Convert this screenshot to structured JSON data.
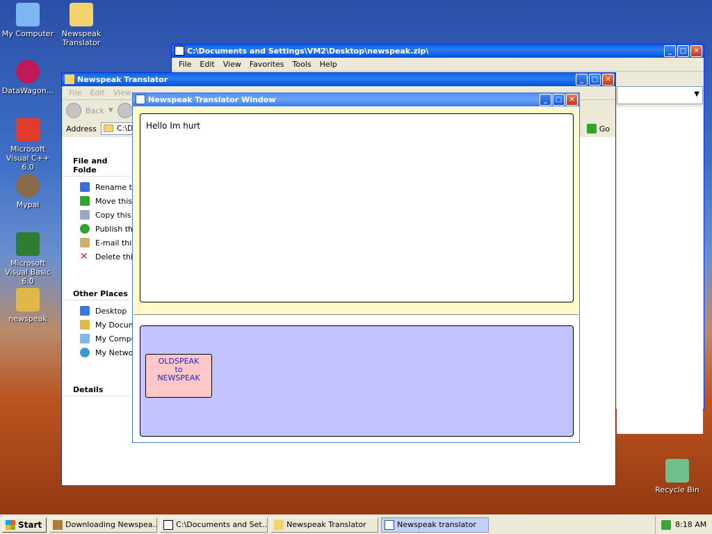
{
  "desktop": {
    "icons": [
      {
        "label": "My Computer",
        "color": "#7eb6f2"
      },
      {
        "label": "Newspeak Translator",
        "color": "#f3d36b"
      },
      {
        "label": "DataWagon...",
        "color": "#c0185a"
      },
      {
        "label": "Microsoft Visual C++ 6.0",
        "color": "#e33b2b"
      },
      {
        "label": "Mypal",
        "color": "#8b6a4a"
      },
      {
        "label": "Microsoft Visual Basic 6.0",
        "color": "#2e7d32"
      },
      {
        "label": "newspeak",
        "color": "#e0b84a"
      },
      {
        "label": "Recycle Bin",
        "color": "#6fbf8a"
      }
    ]
  },
  "zip_window": {
    "title": "C:\\Documents and Settings\\VM2\\Desktop\\newspeak.zip\\",
    "menu": [
      "File",
      "Edit",
      "View",
      "Favorites",
      "Tools",
      "Help"
    ]
  },
  "explorer_window": {
    "title": "Newspeak Translator",
    "menu": [
      "File",
      "Edit",
      "View"
    ],
    "back_label": "Back",
    "address_label": "Address",
    "address_value": "C:\\Do",
    "go_label": "Go",
    "file_tasks_header": "File and Folde",
    "file_tasks": [
      {
        "label": "Rename th",
        "icon": "rename-icon",
        "color": "#3a6fd8"
      },
      {
        "label": "Move this f",
        "icon": "move-icon",
        "color": "#2fa52f"
      },
      {
        "label": "Copy this f",
        "icon": "copy-icon",
        "color": "#9aa8c8"
      },
      {
        "label": "Publish this",
        "icon": "publish-icon",
        "color": "#2fa52f"
      },
      {
        "label": "E-mail this",
        "icon": "email-icon",
        "color": "#d0b070"
      },
      {
        "label": "Delete this",
        "icon": "delete-icon",
        "color": "#d02020"
      }
    ],
    "other_places_header": "Other Places",
    "other_places": [
      {
        "label": "Desktop",
        "icon": "desktop-icon",
        "color": "#3a7ad8"
      },
      {
        "label": "My Docume",
        "icon": "my-documents-icon",
        "color": "#e0b84a"
      },
      {
        "label": "My Compu",
        "icon": "my-computer-icon",
        "color": "#7eb6f2"
      },
      {
        "label": "My Networ",
        "icon": "my-network-icon",
        "color": "#3a9ad8"
      }
    ],
    "details_header": "Details"
  },
  "app_window": {
    "title": "Newspeak Translator Window",
    "input_text": "Hello Im hurt",
    "button_lines": [
      "OLDSPEAK",
      "to",
      "NEWSPEAK"
    ]
  },
  "taskbar": {
    "start_label": "Start",
    "items": [
      {
        "label": "Downloading Newspea...",
        "icon": "download-icon",
        "active": false
      },
      {
        "label": "C:\\Documents and Set...",
        "icon": "7zip-icon",
        "active": false
      },
      {
        "label": "Newspeak Translator",
        "icon": "folder-icon",
        "active": false
      },
      {
        "label": "Newspeak translator",
        "icon": "app-icon",
        "active": true
      }
    ],
    "clock": "8:18 AM"
  }
}
